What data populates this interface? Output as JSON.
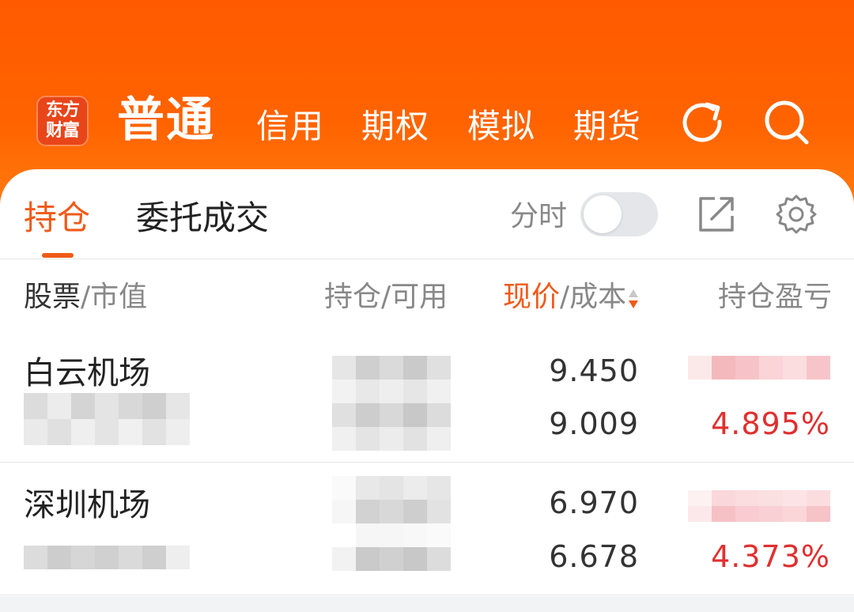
{
  "header": {
    "logo": [
      "东方",
      "财富"
    ],
    "active_tab": "普通",
    "tabs": [
      "信用",
      "期权",
      "模拟",
      "期货"
    ],
    "icons": [
      "refresh-icon",
      "search-icon"
    ],
    "bg_color": "#ff5a00"
  },
  "subtabs": {
    "active": "持仓",
    "other": "委托成交",
    "fenshi_label": "分时",
    "fenshi_on": false,
    "icons": [
      "share-icon",
      "settings-icon"
    ],
    "accent_color": "#f05a19"
  },
  "columns": {
    "stock": "股票",
    "market_value": "/市值",
    "position": "持仓/可用",
    "price": "现价",
    "cost": "/成本",
    "pnl": "持仓盈亏"
  },
  "rows": [
    {
      "name": "白云机场",
      "price": "9.450",
      "cost": "9.009",
      "pnl_pct": "4.895%"
    },
    {
      "name": "深圳机场",
      "price": "6.970",
      "cost": "6.678",
      "pnl_pct": "4.373%"
    }
  ]
}
